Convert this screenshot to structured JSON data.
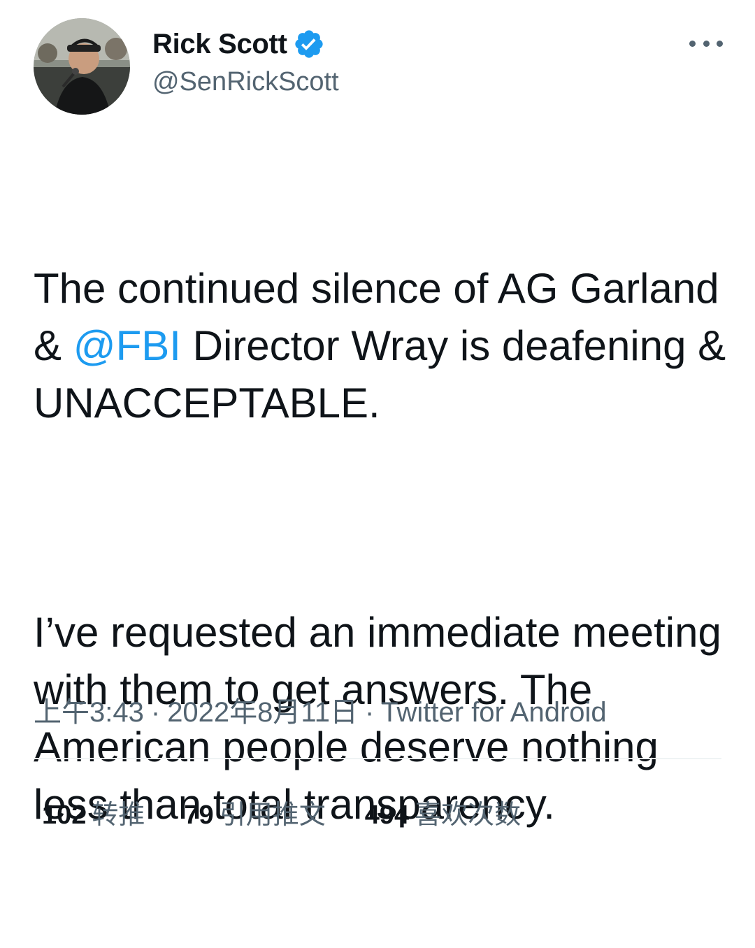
{
  "author": {
    "display_name": "Rick Scott",
    "handle": "@SenRickScott",
    "verified": true,
    "avatar_icon": "profile-photo"
  },
  "tweet": {
    "paragraph1_before_mention": "The continued silence of AG Garland & ",
    "mention": "@FBI",
    "paragraph1_after_mention": " Director Wray is deafening & UNACCEPTABLE.",
    "paragraph2": "I’ve requested an immediate meeting with them to get answers. The American people deserve nothing less than total transparency."
  },
  "meta": {
    "time": "上午3:43",
    "separator": "·",
    "date": "2022年8月11日",
    "source": "Twitter for Android"
  },
  "stats": {
    "retweets": {
      "count": "102",
      "label": "转推"
    },
    "quotes": {
      "count": "79",
      "label": "引用推文"
    },
    "likes": {
      "count": "494",
      "label": "喜欢次数"
    }
  },
  "colors": {
    "accent": "#1d9bf0",
    "secondary_text": "#536471",
    "primary_text": "#0f1419"
  },
  "icons": {
    "more": "more-horizontal-icon",
    "verified": "verified-badge-icon"
  }
}
